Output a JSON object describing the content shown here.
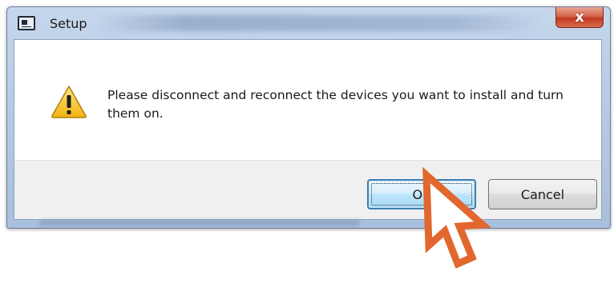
{
  "window": {
    "title": "Setup",
    "close_label": "x"
  },
  "dialog": {
    "message": "Please disconnect and reconnect the devices you want to install and turn them on.",
    "icon": "warning-icon"
  },
  "buttons": {
    "ok_label": "OK",
    "cancel_label": "Cancel"
  },
  "colors": {
    "cursor_arrow": "#e2672f",
    "warning_fill": "#f6c530",
    "close_button": "#c8432a"
  }
}
